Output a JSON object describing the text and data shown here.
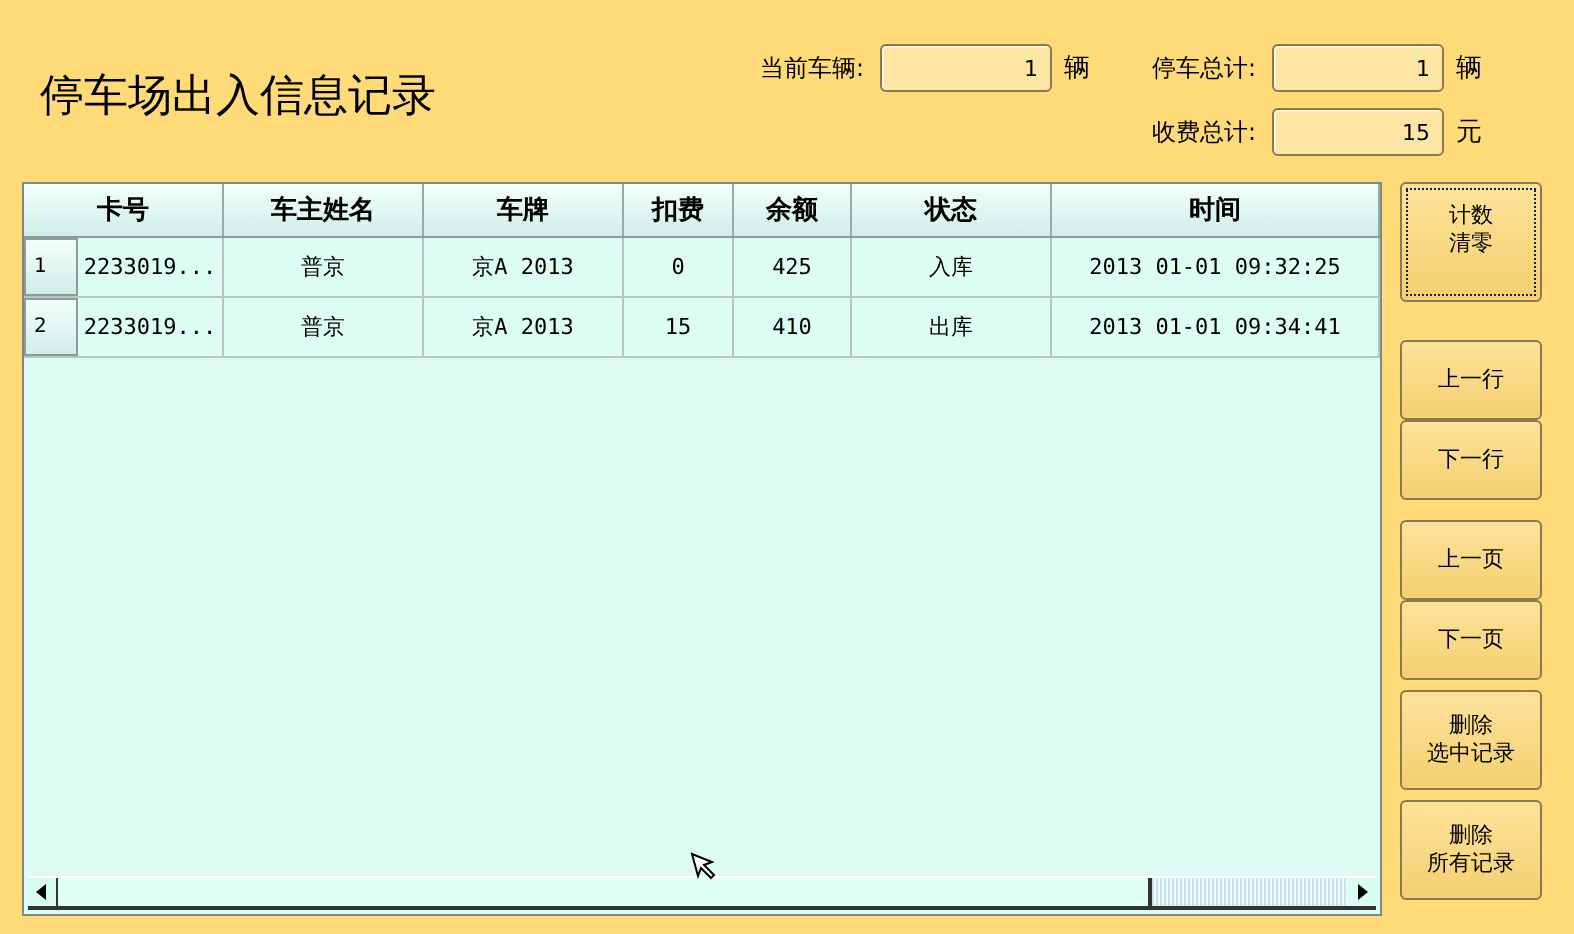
{
  "title": "停车场出入信息记录",
  "counters": [
    {
      "label": "当前车辆:",
      "value": "1",
      "unit": "辆"
    },
    {
      "label": "停车总计:",
      "value": "1",
      "unit": "辆"
    },
    {
      "label": "收费总计:",
      "value": "15",
      "unit": "元"
    }
  ],
  "table": {
    "columns": [
      "卡号",
      "车主姓名",
      "车牌",
      "扣费",
      "余额",
      "状态",
      "时间"
    ],
    "rows": [
      {
        "index": "1",
        "cells": [
          "2233019...",
          "普京",
          "京A 2013",
          "0",
          "425",
          "入库",
          "2013 01-01 09:32:25"
        ]
      },
      {
        "index": "2",
        "cells": [
          "2233019...",
          "普京",
          "京A 2013",
          "15",
          "410",
          "出库",
          "2013 01-01 09:34:41"
        ]
      }
    ]
  },
  "buttons": [
    {
      "lines": [
        "计数",
        "清零"
      ],
      "focused": true,
      "kind": "tall"
    },
    {
      "lines": [
        "上一行"
      ],
      "focused": false,
      "kind": "nav"
    },
    {
      "lines": [
        "下一行"
      ],
      "focused": false,
      "kind": "nav"
    },
    {
      "lines": [
        "上一页"
      ],
      "focused": false,
      "kind": "nav"
    },
    {
      "lines": [
        "下一页"
      ],
      "focused": false,
      "kind": "nav"
    },
    {
      "lines": [
        "删除",
        "选中记录"
      ],
      "focused": false,
      "kind": "double"
    },
    {
      "lines": [
        "删除",
        "所有记录"
      ],
      "focused": false,
      "kind": "double"
    }
  ]
}
